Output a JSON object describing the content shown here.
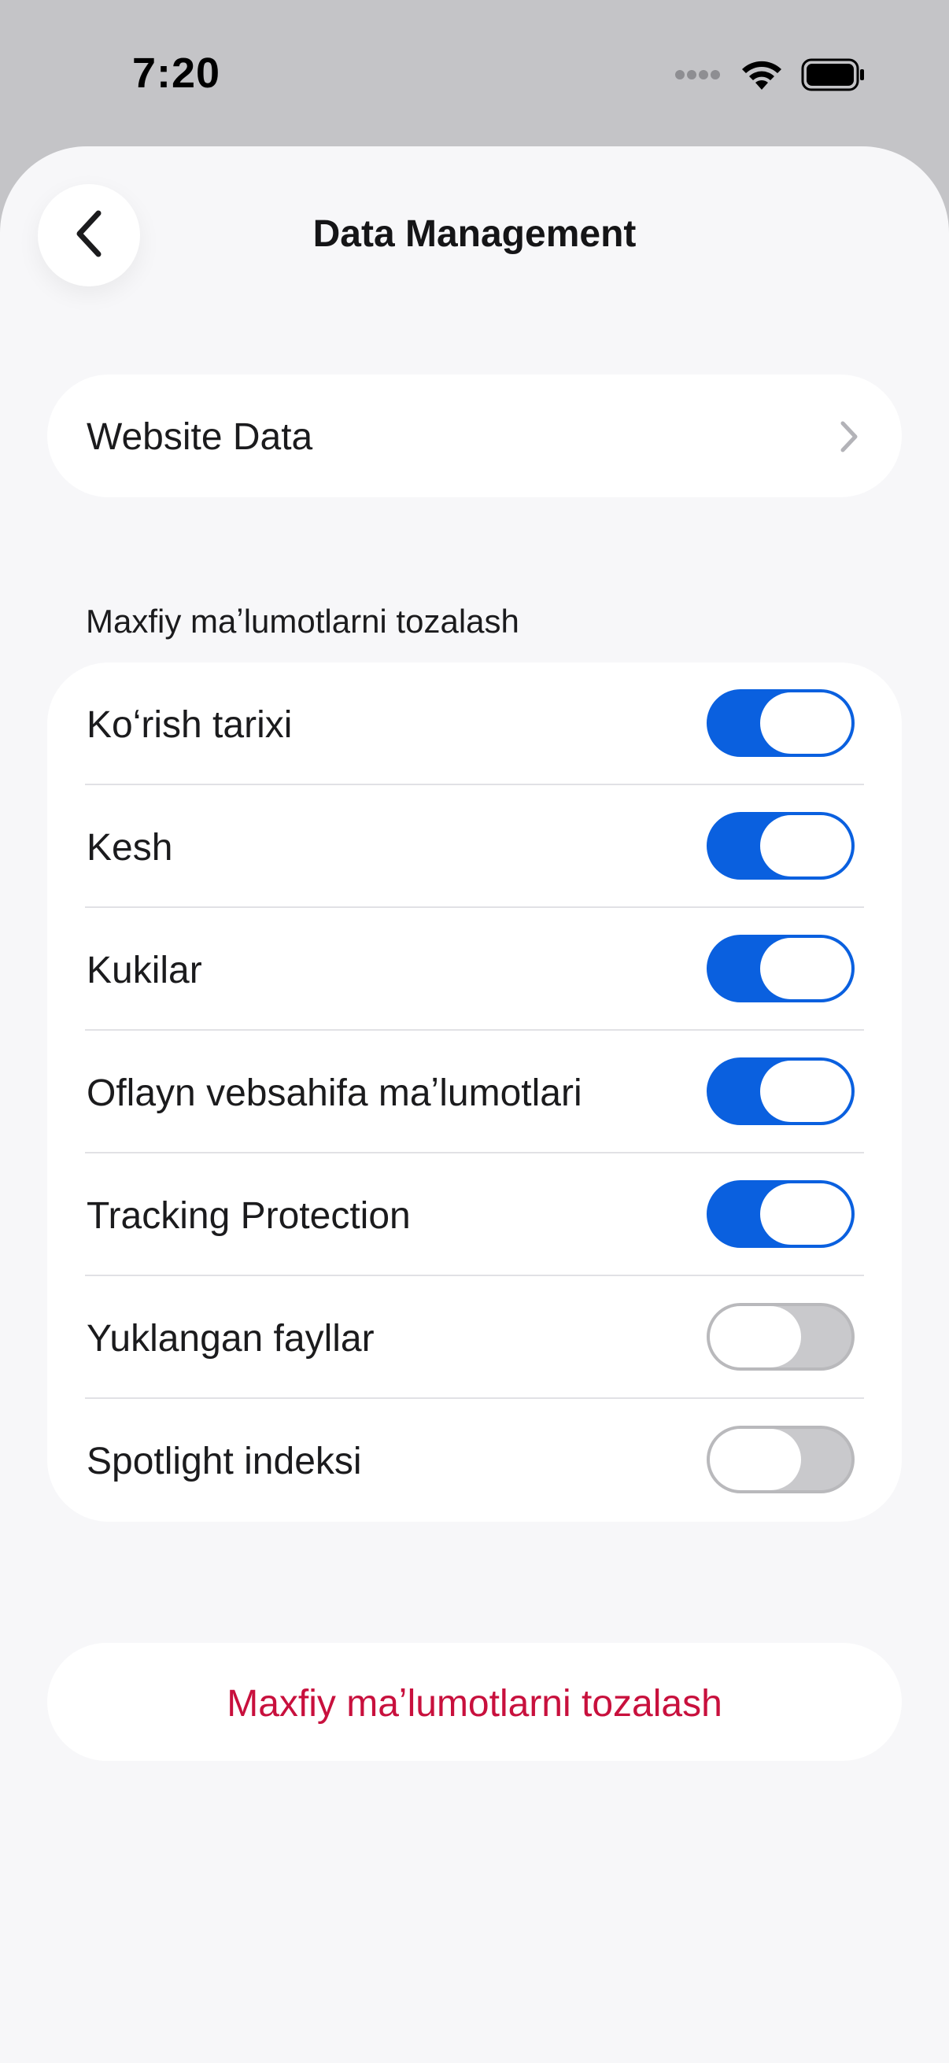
{
  "status_bar": {
    "time": "7:20",
    "icons": [
      "signal-dots-icon",
      "wifi-icon",
      "battery-icon"
    ]
  },
  "nav": {
    "title": "Data Management",
    "back_icon": "chevron-left-icon"
  },
  "website_data": {
    "label": "Website Data",
    "icon": "chevron-right-icon"
  },
  "clear_section": {
    "header": "Maxfiy maʼlumotlarni tozalash",
    "items": [
      {
        "label": "Koʻrish tarixi",
        "on": true
      },
      {
        "label": "Kesh",
        "on": true
      },
      {
        "label": "Kukilar",
        "on": true
      },
      {
        "label": "Oflayn vebsahifa maʼlumotlari",
        "on": true
      },
      {
        "label": "Tracking Protection",
        "on": true
      },
      {
        "label": "Yuklangan fayllar",
        "on": false
      },
      {
        "label": "Spotlight indeksi",
        "on": false
      }
    ]
  },
  "clear_button": {
    "label": "Maxfiy maʼlumotlarni tozalash"
  },
  "colors": {
    "accent": "#0a60df",
    "destructive": "#c8103d",
    "background": "#f7f7f9",
    "status_bar_bg": "#c4c4c7"
  }
}
